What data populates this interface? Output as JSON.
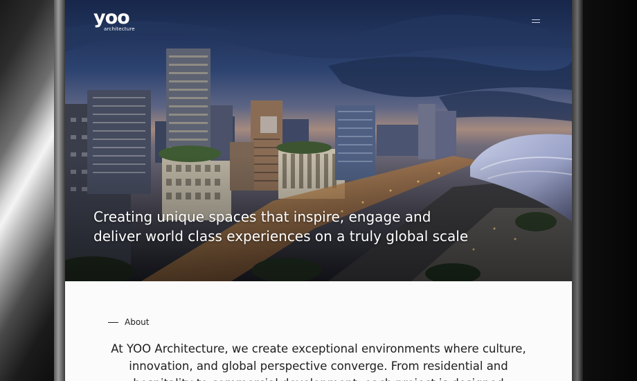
{
  "header": {
    "logo_word": "yoo",
    "logo_sub": "architecture",
    "menu_icon": "hamburger-menu-icon"
  },
  "hero": {
    "headline_line1": "Creating unique spaces that inspire, engage and",
    "headline_line2": "deliver world class experiences on a truly global scale"
  },
  "about": {
    "label": "About",
    "text": "At YOO Architecture, we create exceptional environments where culture, innovation, and global perspective converge. From residential and hospitality to commercial development, each project is designed"
  },
  "colors": {
    "hero_text": "#ffffff",
    "body_text": "#1e1e1e",
    "section_bg": "#fbfbfb"
  }
}
